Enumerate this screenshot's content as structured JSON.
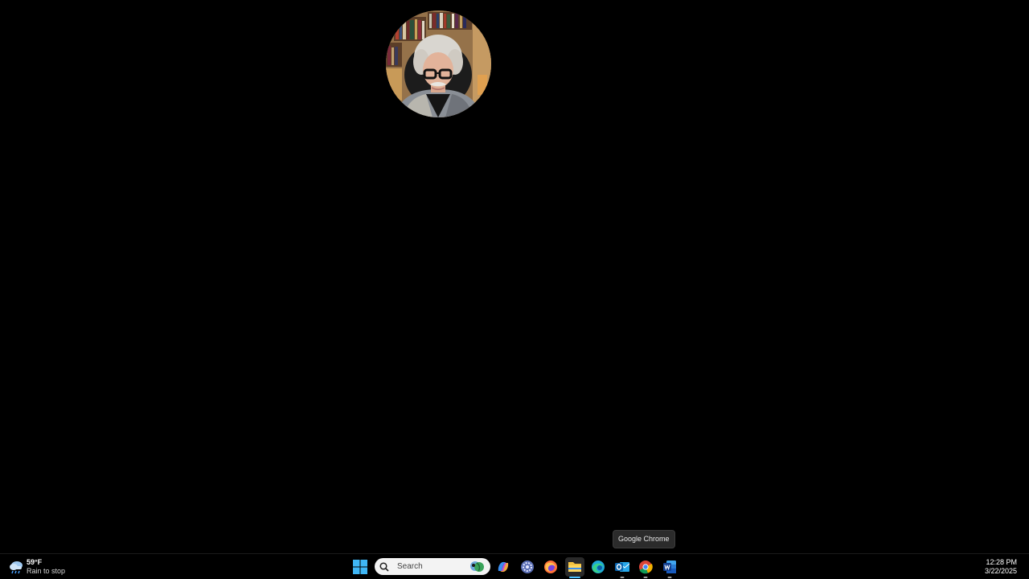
{
  "webcam": {
    "label": "webcam-overlay"
  },
  "tooltip": {
    "text": "Google Chrome"
  },
  "taskbar": {
    "weather": {
      "temp": "59°F",
      "condition": "Rain to stop",
      "icon": "rain-cloud-icon"
    },
    "search": {
      "placeholder": "Search"
    },
    "apps": [
      {
        "name": "copilot",
        "icon": "copilot-icon"
      },
      {
        "name": "settings-app",
        "icon": "gear-icon"
      },
      {
        "name": "firefox",
        "icon": "firefox-icon"
      },
      {
        "name": "file-explorer",
        "icon": "folder-icon",
        "active": true
      },
      {
        "name": "edge",
        "icon": "edge-icon"
      },
      {
        "name": "outlook",
        "icon": "outlook-icon",
        "running": true
      },
      {
        "name": "chrome",
        "icon": "chrome-icon",
        "running": true
      },
      {
        "name": "word",
        "icon": "word-icon",
        "running": true
      }
    ],
    "clock": {
      "time": "12:28 PM",
      "date": "3/22/2025"
    }
  },
  "colors": {
    "accent": "#4cc2ff",
    "taskbar_bg": "#000000",
    "desktop_bg": "#000000"
  }
}
